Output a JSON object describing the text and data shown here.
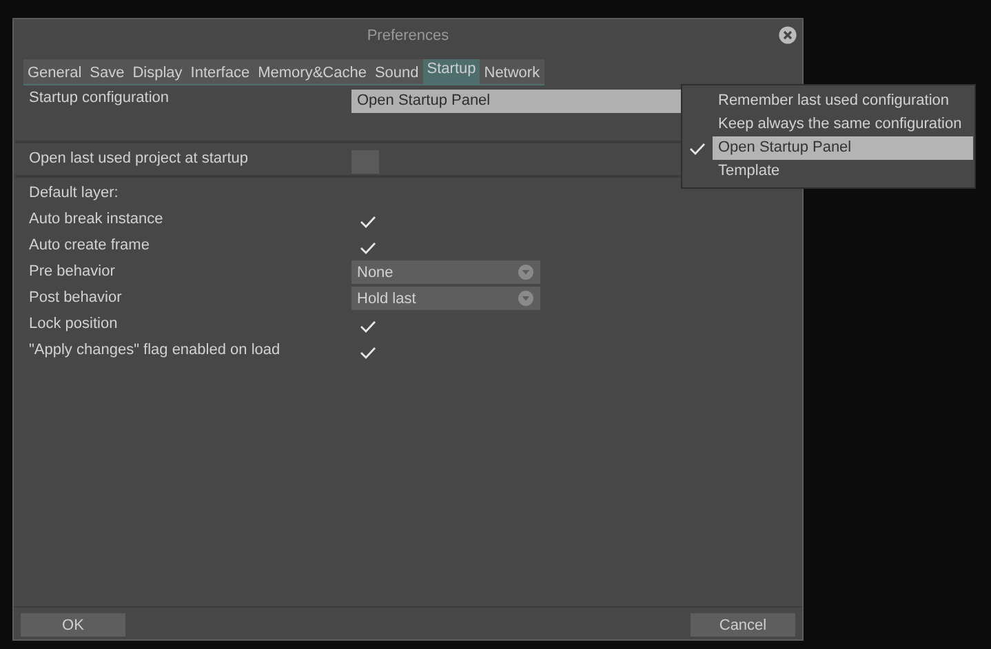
{
  "window": {
    "title": "Preferences"
  },
  "tabs": [
    {
      "label": "General",
      "selected": false
    },
    {
      "label": "Save",
      "selected": false
    },
    {
      "label": "Display",
      "selected": false
    },
    {
      "label": "Interface",
      "selected": false
    },
    {
      "label": "Memory&Cache",
      "selected": false
    },
    {
      "label": "Sound",
      "selected": false
    },
    {
      "label": "Startup",
      "selected": true
    },
    {
      "label": "Network",
      "selected": false
    }
  ],
  "top_rows": [
    {
      "kind": "field",
      "label": "Startup configuration",
      "value": "Open Startup Panel"
    },
    {
      "kind": "check",
      "label": "Open last used project at startup",
      "checked": false
    }
  ],
  "rows": [
    {
      "kind": "heading",
      "label": "Default layer:"
    },
    {
      "kind": "check",
      "label": "Auto break instance",
      "checked": true
    },
    {
      "kind": "check",
      "label": "Auto create frame",
      "checked": true
    },
    {
      "kind": "select",
      "label": "Pre behavior",
      "value": "None"
    },
    {
      "kind": "select",
      "label": "Post behavior",
      "value": "Hold last"
    },
    {
      "kind": "check",
      "label": "Lock position",
      "checked": true
    },
    {
      "kind": "check",
      "label": "\"Apply changes\" flag enabled on load",
      "checked": true
    }
  ],
  "menu": [
    {
      "label": "Remember last used configuration",
      "selected": false
    },
    {
      "label": "Keep always the same configuration",
      "selected": false
    },
    {
      "label": "Open Startup Panel",
      "selected": true
    },
    {
      "label": "Template",
      "selected": false
    }
  ],
  "buttons": {
    "ok": "OK",
    "cancel": "Cancel"
  }
}
